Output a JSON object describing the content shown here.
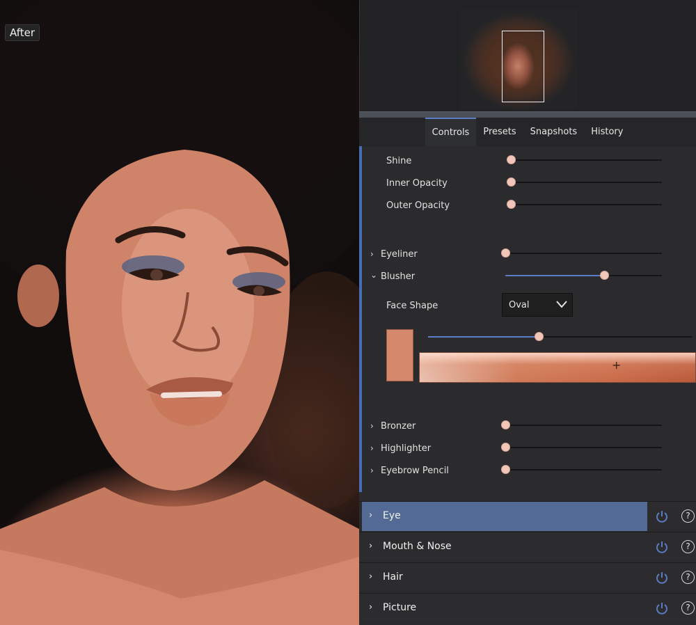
{
  "preview": {
    "badge": "After"
  },
  "tabs": {
    "items": [
      "Controls",
      "Presets",
      "Snapshots",
      "History"
    ],
    "active": "Controls"
  },
  "controls": {
    "sliders": [
      {
        "label": "Shine",
        "value": 0.0
      },
      {
        "label": "Inner Opacity",
        "value": 0.0
      },
      {
        "label": "Outer Opacity",
        "value": 0.0
      }
    ],
    "eyeliner": {
      "label": "Eyeliner",
      "value": 0.0,
      "expanded": false
    },
    "blusher": {
      "label": "Blusher",
      "value": 0.63,
      "expanded": true
    },
    "face_shape": {
      "label": "Face Shape",
      "value": "Oval"
    },
    "blusher_color": {
      "swatch": "#d4896d",
      "strength": 0.42
    },
    "bronzer": {
      "label": "Bronzer",
      "value": 0.0
    },
    "highlighter": {
      "label": "Highlighter",
      "value": 0.0
    },
    "eyebrow_pencil": {
      "label": "Eyebrow Pencil",
      "value": 0.0
    }
  },
  "sections": [
    {
      "label": "Eye",
      "selected": true,
      "icon_power": "power-icon",
      "icon_help": "help-icon"
    },
    {
      "label": "Mouth & Nose",
      "selected": false,
      "icon_power": "power-icon",
      "icon_help": "help-icon"
    },
    {
      "label": "Hair",
      "selected": false,
      "icon_power": "power-icon",
      "icon_help": "help-icon"
    },
    {
      "label": "Picture",
      "selected": false,
      "icon_power": "power-icon",
      "icon_help": "help-icon"
    }
  ],
  "colors": {
    "accent": "#5b7cc4",
    "selected_section": "#536a94",
    "slider_thumb": "#f1c6b8"
  },
  "icons": {
    "chevron_right": "›",
    "chevron_down": "⌄",
    "help": "?"
  }
}
